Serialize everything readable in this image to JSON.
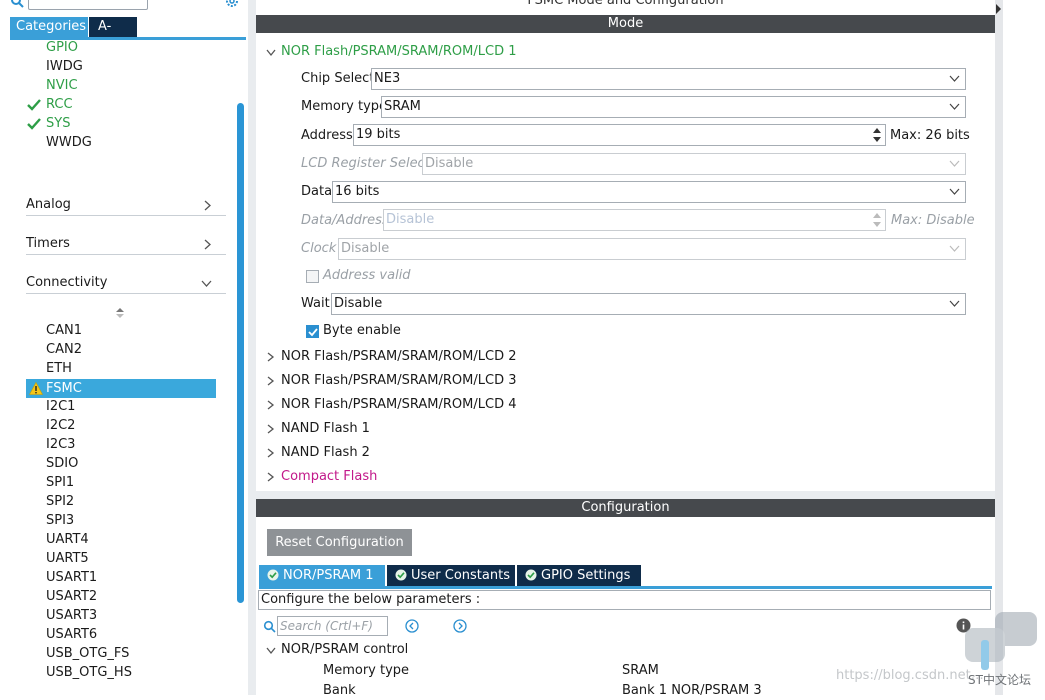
{
  "left_panel": {
    "tabs": {
      "categories": "Categories",
      "az": "A->Z"
    },
    "system_items": [
      {
        "label": "GPIO",
        "color": "#2e9e47",
        "checked": false
      },
      {
        "label": "IWDG",
        "color": "#1a1a1a",
        "checked": false
      },
      {
        "label": "NVIC",
        "color": "#2e9e47",
        "checked": false
      },
      {
        "label": "RCC",
        "color": "#2e9e47",
        "checked": true
      },
      {
        "label": "SYS",
        "color": "#2e9e47",
        "checked": true
      },
      {
        "label": "WWDG",
        "color": "#1a1a1a",
        "checked": false
      }
    ],
    "categories": {
      "analog": "Analog",
      "timers": "Timers",
      "connectivity": "Connectivity"
    },
    "connectivity_items": [
      "CAN1",
      "CAN2",
      "ETH",
      "FSMC",
      "I2C1",
      "I2C2",
      "I2C3",
      "SDIO",
      "SPI1",
      "SPI2",
      "SPI3",
      "UART4",
      "UART5",
      "USART1",
      "USART2",
      "USART3",
      "USART6",
      "USB_OTG_FS",
      "USB_OTG_HS"
    ],
    "selected_item": "FSMC"
  },
  "mode_panel": {
    "title": "FSMC Mode and Configuration",
    "mode_header": "Mode",
    "nor1": {
      "title": "NOR Flash/PSRAM/SRAM/ROM/LCD 1",
      "chip_select_label": "Chip Select",
      "chip_select_value": "NE3",
      "memory_type_label": "Memory type",
      "memory_type_value": "SRAM",
      "address_label": "Address",
      "address_value": "19 bits",
      "address_max": "Max: 26 bits",
      "lcd_reg_label": "LCD Register Select",
      "lcd_reg_value": "Disable",
      "data_label": "Data",
      "data_value": "16 bits",
      "data_address_label": "Data/Address",
      "data_address_value": "Disable",
      "data_address_max": "Max: Disable",
      "clock_label": "Clock",
      "clock_value": "Disable",
      "address_valid_label": "Address valid",
      "wait_label": "Wait",
      "wait_value": "Disable",
      "byte_enable_label": "Byte enable"
    },
    "collapsed_sections": [
      "NOR Flash/PSRAM/SRAM/ROM/LCD 2",
      "NOR Flash/PSRAM/SRAM/ROM/LCD 3",
      "NOR Flash/PSRAM/SRAM/ROM/LCD 4",
      "NAND Flash 1",
      "NAND Flash 2",
      "Compact Flash"
    ]
  },
  "config_panel": {
    "header": "Configuration",
    "reset_button": "Reset Configuration",
    "tabs": [
      "NOR/PSRAM 1",
      "User Constants",
      "GPIO Settings"
    ],
    "configure_text": "Configure the below parameters :",
    "search_placeholder": "Search (Crtl+F)",
    "group_title": "NOR/PSRAM control",
    "params": [
      {
        "key": "Memory type",
        "value": "SRAM"
      },
      {
        "key": "Bank",
        "value": "Bank 1 NOR/PSRAM 3"
      }
    ]
  },
  "watermark": {
    "url": "https://blog.csdn.net",
    "suffix": "…",
    "brand": "ST中文论坛"
  },
  "colors": {
    "accent_blue": "#3a9fd8",
    "dark_navy": "#0f2c4a",
    "enabled_green": "#2e9e47",
    "compact_flash_magenta": "#c2188a",
    "header_gray": "#46494d"
  }
}
